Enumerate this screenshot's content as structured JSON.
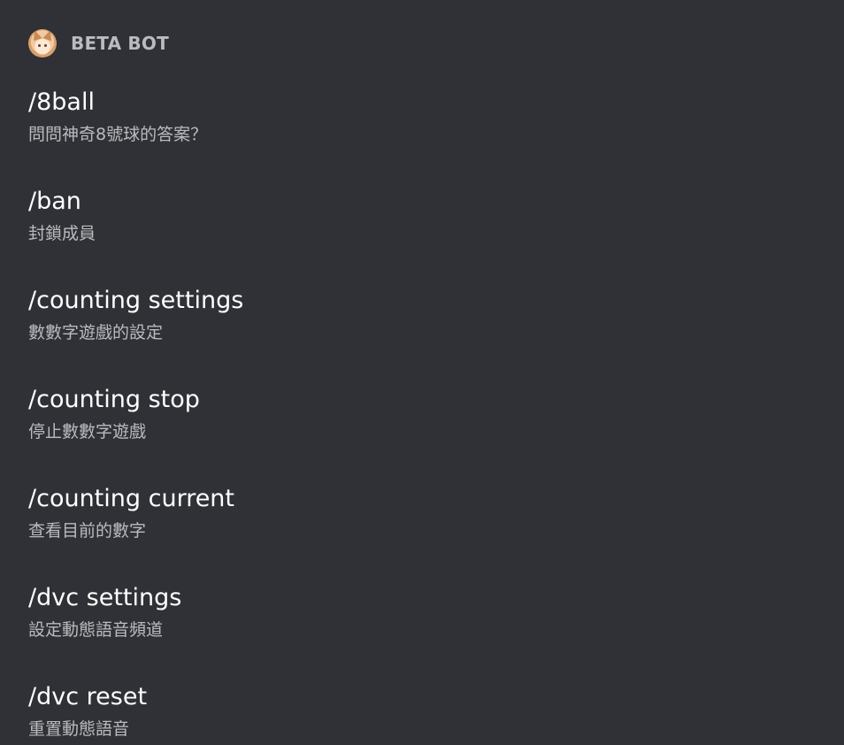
{
  "bot": {
    "name": "BETA BOT",
    "avatar_icon": "fox-girl-avatar"
  },
  "commands": [
    {
      "name": "/8ball",
      "description": "問問神奇8號球的答案？"
    },
    {
      "name": "/ban",
      "description": "封鎖成員"
    },
    {
      "name": "/counting settings",
      "description": "數數字遊戲的設定"
    },
    {
      "name": "/counting stop",
      "description": "停止數數字遊戲"
    },
    {
      "name": "/counting current",
      "description": "查看目前的數字"
    },
    {
      "name": "/dvc settings",
      "description": "設定動態語音頻道"
    },
    {
      "name": "/dvc reset",
      "description": "重置動態語音"
    }
  ],
  "colors": {
    "background": "#2f3136",
    "header_text": "#b9bbbe",
    "command_text": "#ffffff",
    "description_text": "#b9bbbe"
  }
}
